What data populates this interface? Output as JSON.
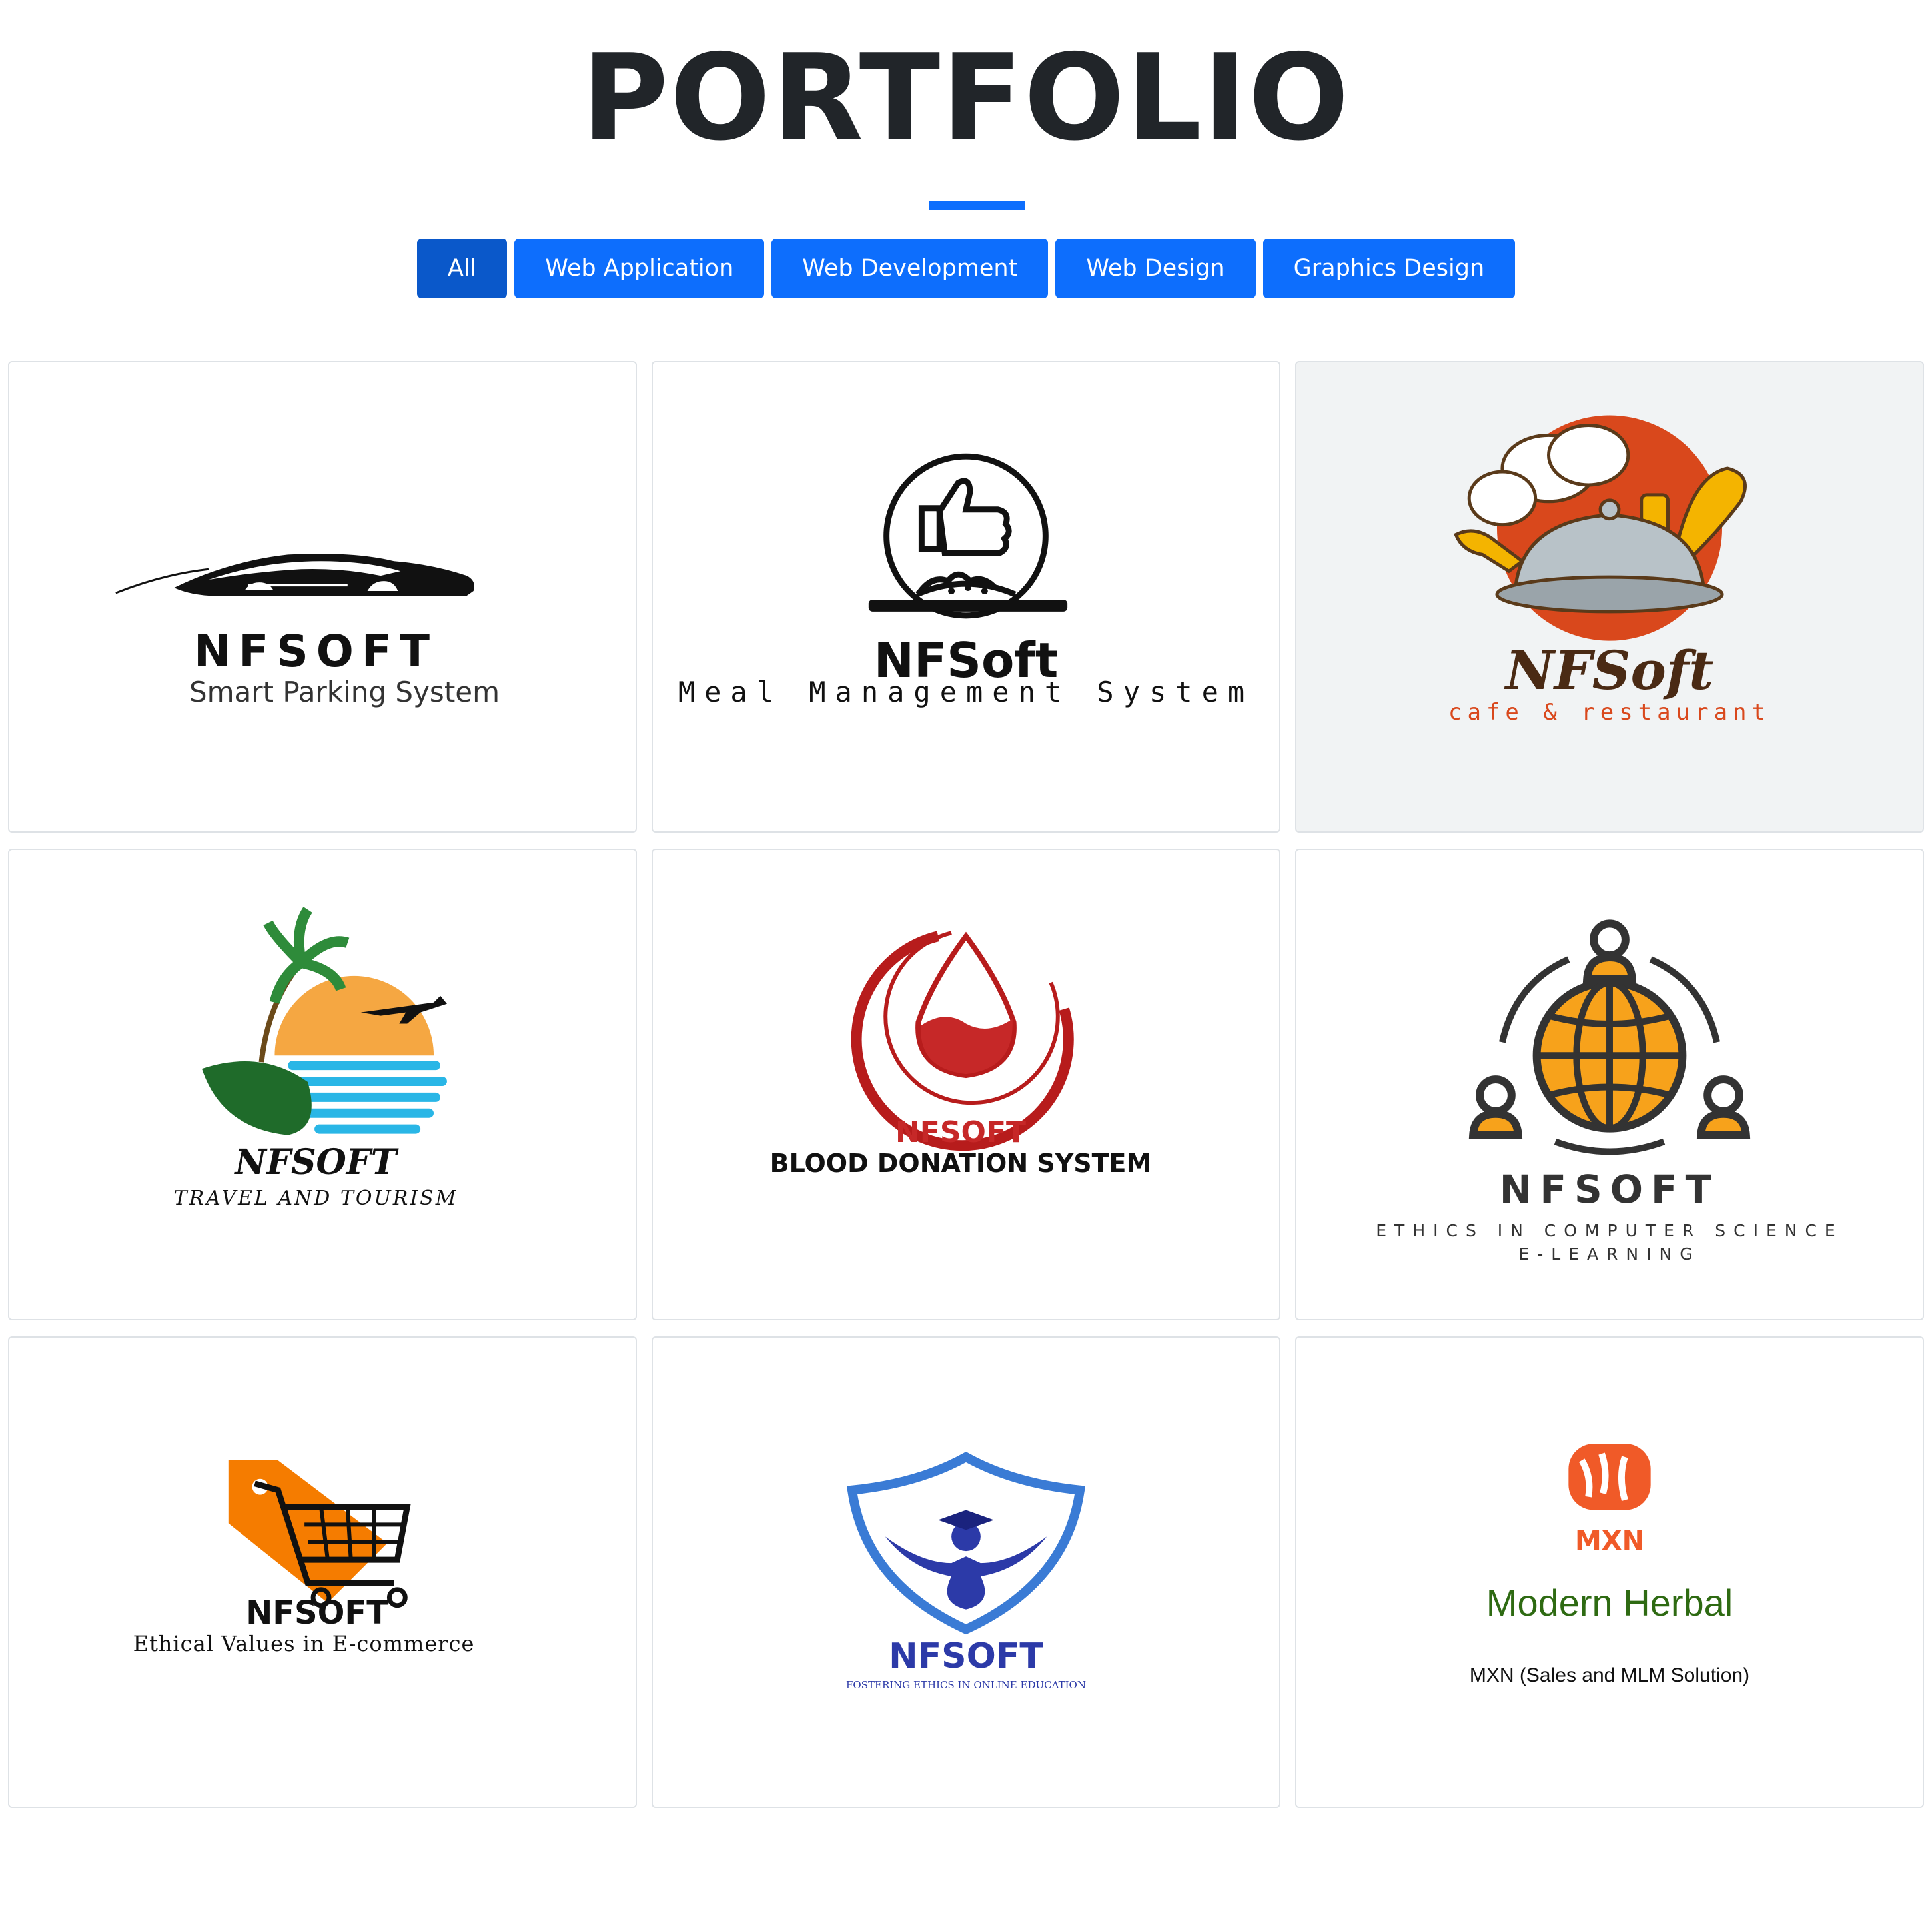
{
  "page": {
    "title": "PORTFOLIO"
  },
  "filters": [
    "All",
    "Web Application",
    "Web Development",
    "Web Design",
    "Graphics Design"
  ],
  "active_filter": "All",
  "colors": {
    "accent": "#0d6efd",
    "accent_active": "#0a58ca",
    "title": "#212529"
  },
  "portfolio": [
    {
      "brand": "NFSOFT",
      "subtitle": "Smart Parking System",
      "icon": "car-icon"
    },
    {
      "brand": "NFSoft",
      "subtitle": "Meal Management System",
      "icon": "thumbs-up-meal-icon"
    },
    {
      "brand": "NFSoft",
      "subtitle": "cafe & restaurant",
      "icon": "chef-hat-cloche-icon"
    },
    {
      "brand": "NFSOFT",
      "subtitle": "TRAVEL AND TOURISM",
      "icon": "palm-beach-plane-icon"
    },
    {
      "brand": "NFSOFT",
      "subtitle": "BLOOD DONATION SYSTEM",
      "icon": "blood-drop-icon"
    },
    {
      "brand": "NFSOFT",
      "subtitle": "ETHICS IN COMPUTER SCIENCE",
      "subtitle2": "E-LEARNING",
      "icon": "globe-people-icon"
    },
    {
      "brand": "NFSOFT",
      "subtitle": "Ethical Values in E-commerce",
      "icon": "shopping-cart-tag-icon"
    },
    {
      "brand": "NFSOFT",
      "subtitle": "FOSTERING ETHICS IN ONLINE EDUCATION",
      "icon": "shield-graduate-icon"
    },
    {
      "brand": "MXN",
      "subtitle": "Modern Herbal",
      "subtitle2": "MXN (Sales and MLM Solution)",
      "icon": "herbal-hands-icon"
    }
  ]
}
